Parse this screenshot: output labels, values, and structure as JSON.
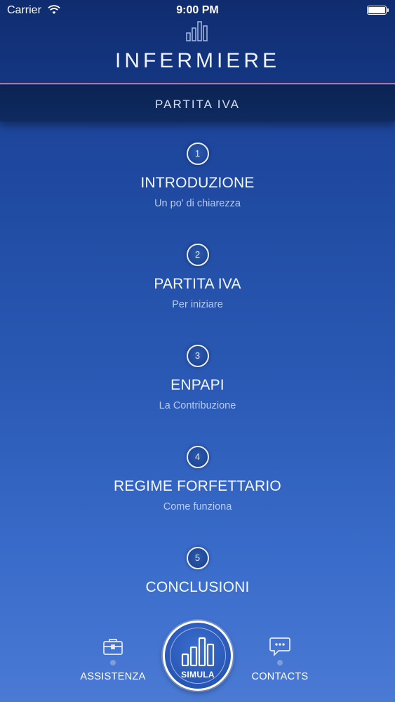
{
  "status_bar": {
    "carrier": "Carrier",
    "time": "9:00 PM",
    "icons": [
      "wifi-icon",
      "battery-icon"
    ]
  },
  "header": {
    "logo_icon": "bar-chart-icon",
    "title": "INFERMIERE"
  },
  "section": {
    "title": "PARTITA IVA"
  },
  "menu": {
    "items": [
      {
        "number": "1",
        "title": "INTRODUZIONE",
        "subtitle": "Un po' di chiarezza"
      },
      {
        "number": "2",
        "title": "PARTITA IVA",
        "subtitle": "Per iniziare"
      },
      {
        "number": "3",
        "title": "ENPAPI",
        "subtitle": "La Contribuzione"
      },
      {
        "number": "4",
        "title": "REGIME FORFETTARIO",
        "subtitle": "Come funziona"
      },
      {
        "number": "5",
        "title": "CONCLUSIONI"
      }
    ]
  },
  "tab_bar": {
    "assistenza": {
      "label": "ASSISTENZA",
      "icon": "briefcase-icon"
    },
    "simula": {
      "label": "SIMULA",
      "icon": "bar-chart-icon"
    },
    "contacts": {
      "label": "CONTACTS",
      "icon": "chat-bubble-icon"
    }
  },
  "colors": {
    "header_bg": "#0f2c6f",
    "section_bg": "#0b2353",
    "accent_line": "#d76a7d",
    "gradient_top": "#14347f",
    "gradient_bottom": "#4a7ad4",
    "subtitle_text": "#b9cbef"
  }
}
